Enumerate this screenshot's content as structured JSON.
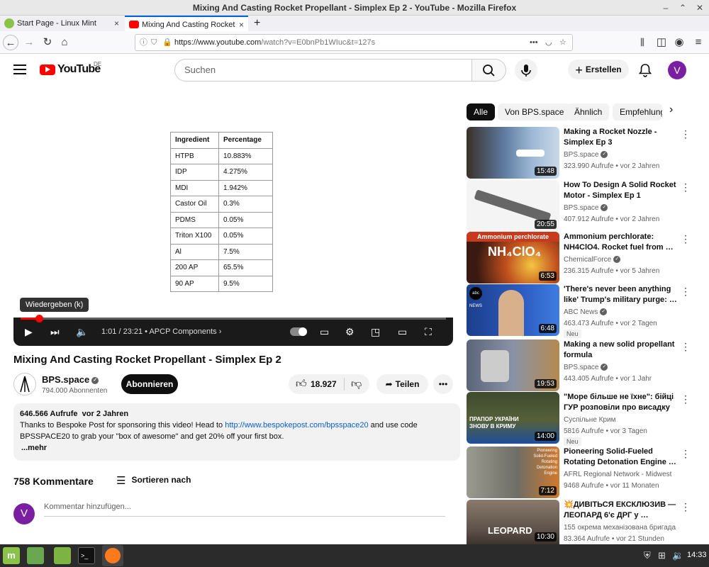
{
  "window": {
    "title": "Mixing And Casting Rocket Propellant - Simplex Ep 2 - YouTube - Mozilla Firefox"
  },
  "tabs": [
    {
      "label": "Start Page - Linux Mint",
      "close": "×"
    },
    {
      "label": "Mixing And Casting Rocket",
      "close": "×"
    }
  ],
  "newtab": "+",
  "nav": {
    "url_domain": "https://www.youtube.com",
    "url_path": "/watch?v=E0bnPb1WIuc&t=127s",
    "more": "•••"
  },
  "yt_header": {
    "logo_text": "YouTube",
    "region": "DE",
    "search_placeholder": "Suchen",
    "create_label": "Erstellen",
    "avatar_letter": "V"
  },
  "chips": [
    "Alle",
    "Von BPS.space",
    "Ähnlich",
    "Empfehlung"
  ],
  "player": {
    "table_headers": [
      "Ingredient",
      "Percentage"
    ],
    "table_rows": [
      [
        "HTPB",
        "10.883%"
      ],
      [
        "IDP",
        "4.275%"
      ],
      [
        "MDI",
        "1.942%"
      ],
      [
        "Castor Oil",
        "0.3%"
      ],
      [
        "PDMS",
        "0.05%"
      ],
      [
        "Triton X100",
        "0.05%"
      ],
      [
        "Al",
        "7.5%"
      ],
      [
        "200 AP",
        "65.5%"
      ],
      [
        "90 AP",
        "9.5%"
      ]
    ],
    "tooltip": "Wiedergeben (k)",
    "time": "1:01 / 23:21",
    "chapter": "APCP Components",
    "progress": 0.044
  },
  "video": {
    "title": "Mixing And Casting Rocket Propellant - Simplex Ep 2",
    "channel": "BPS.space",
    "subscribers": "794.000 Abonnenten",
    "subscribe_label": "Abonnieren",
    "likes": "18.927",
    "share_label": "Teilen",
    "views": "646.566 Aufrufe",
    "age": "vor 2 Jahren",
    "desc_line1_pre": "Thanks to Bespoke Post for sponsoring this video! Head to ",
    "desc_link": "http://www.bespokepost.com/bpsspace20",
    "desc_line1_post": " and use code",
    "desc_line2": "BPSSPACE20 to grab your \"box of awesome\" and get 20% off your first box.",
    "more_label": "...mehr"
  },
  "comments": {
    "count_label": "758 Kommentare",
    "sort_label": "Sortieren nach",
    "placeholder": "Kommentar hinzufügen...",
    "avatar_letter": "V"
  },
  "recommendations": [
    {
      "title": "Making a Rocket Nozzle - Simplex Ep 3",
      "channel": "BPS.space",
      "verified": true,
      "meta": "323.990 Aufrufe • vor 2 Jahren",
      "duration": "15:48",
      "badge": "",
      "thumb_color": "#6b8fb5"
    },
    {
      "title": "How To Design A Solid Rocket Motor - Simplex Ep 1",
      "channel": "BPS.space",
      "verified": true,
      "meta": "407.912 Aufrufe • vor 2 Jahren",
      "duration": "20:55",
      "badge": "",
      "thumb_color": "#e8e8e8"
    },
    {
      "title": "Ammonium perchlorate: NH4ClO4. Rocket fuel from …",
      "channel": "ChemicalForce",
      "verified": true,
      "meta": "236.315 Aufrufe • vor 5 Jahren",
      "duration": "6:53",
      "badge": "",
      "thumb_color": "#5a2c1e"
    },
    {
      "title": "'There's never been anything like' Trump's military purge: …",
      "channel": "ABC News",
      "verified": true,
      "meta": "463.473 Aufrufe • vor 2 Tagen",
      "duration": "6:48",
      "badge": "Neu",
      "thumb_color": "#1c3f8a"
    },
    {
      "title": "Making a new solid propellant formula",
      "channel": "BPS.space",
      "verified": true,
      "meta": "443.405 Aufrufe • vor 1 Jahr",
      "duration": "19:53",
      "badge": "",
      "thumb_color": "#6a7385"
    },
    {
      "title": "\"Море більше не їхне\": бійці ГУР розповіли про висадку в…",
      "channel": "Суспільне Крим",
      "verified": false,
      "meta": "5816 Aufrufe • vor 3 Tagen",
      "duration": "14:00",
      "badge": "Neu",
      "thumb_color": "#3d4a2c"
    },
    {
      "title": "Pioneering Solid-Fueled Rotating Detonation Engine …",
      "channel": "AFRL Regional Network - Midwest",
      "verified": false,
      "meta": "9468 Aufrufe • vor 11 Monaten",
      "duration": "7:12",
      "badge": "",
      "thumb_color": "#8a8a80"
    },
    {
      "title": "💥ДИВІТЬСЯ ЕКСКЛЮЗИВ — ЛЕОПАРД 6'є ДРГ у …",
      "channel": "155 окрема механізована бригада",
      "verified": false,
      "meta": "83.364 Aufrufe • vor 21 Stunden",
      "duration": "10:30",
      "badge": "",
      "thumb_color": "#7a6b5c"
    }
  ],
  "thumb_texts": {
    "ammonium_banner": "Ammonium perchlorate",
    "ammonium_formula": "NH₄ClO₄",
    "abc_logo": "abc NEWS",
    "pioneer_text": "Pioneering Solid-Fueled Rotating Detonation Engine",
    "leopard_text": "LEOPARD",
    "prapor_text": "ПРАПОР УКРАЇНИ ЗНОВУ В КРИМУ"
  },
  "taskbar": {
    "clock": "14:33"
  },
  "colors": {
    "youtube_red": "#ff0000",
    "link_blue": "#065fd4",
    "chip_active_bg": "#0f0f0f",
    "avatar_purple": "#7b1fa2",
    "mint_green": "#8bc34a"
  }
}
